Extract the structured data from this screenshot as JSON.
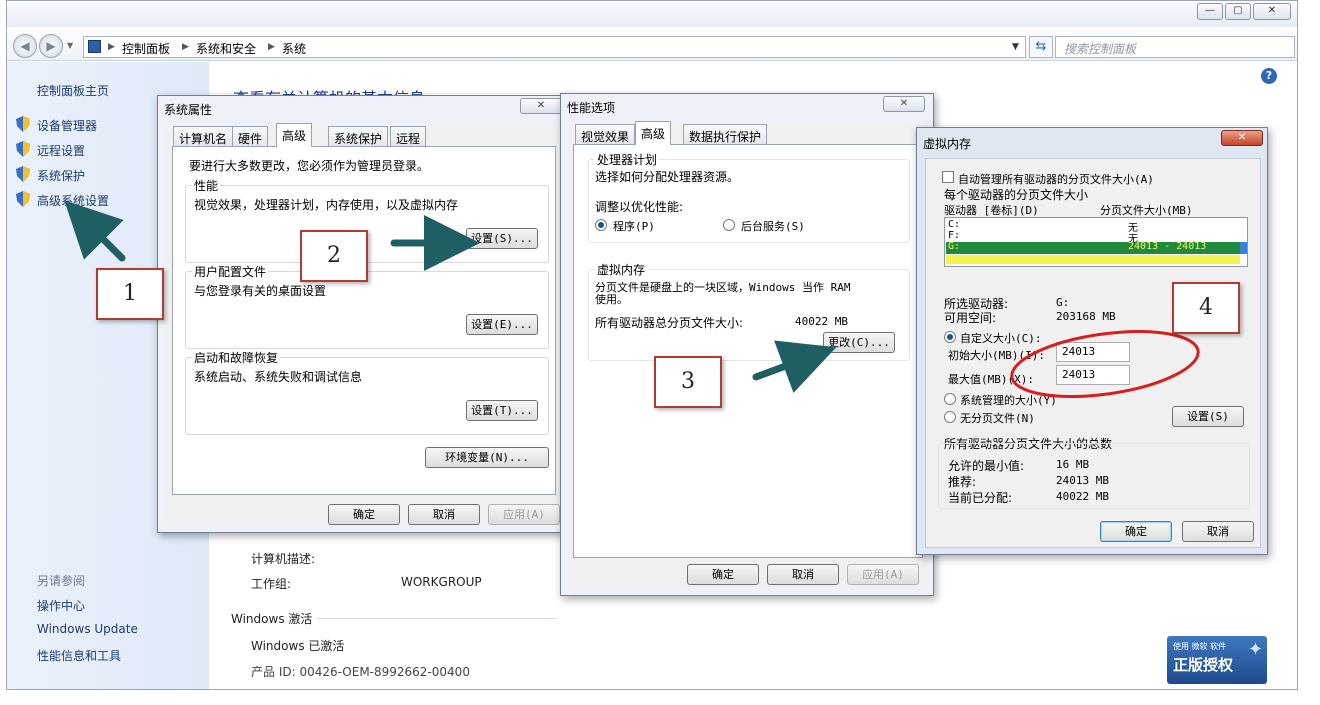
{
  "main_window": {
    "breadcrumb": [
      "控制面板",
      "系统和安全",
      "系统"
    ],
    "search_placeholder": "搜索控制面板",
    "heading": "查看有关计算机的基本信息",
    "left_pane": {
      "home": "控制面板主页",
      "items": [
        "设备管理器",
        "远程设置",
        "系统保护",
        "高级系统设置"
      ],
      "see_also_title": "另请参阅",
      "see_also": [
        "操作中心",
        "Windows Update",
        "性能信息和工具"
      ]
    },
    "computer_desc_label": "计算机描述:",
    "workgroup_label": "工作组:",
    "workgroup_value": "WORKGROUP",
    "activation_title": "Windows 激活",
    "activation_status": "Windows 已激活",
    "product_id_partial": "产品 ID: 00426-OEM-8992662-00400",
    "genuine_badge_top": "使用 微软 软件",
    "genuine_badge_main": "正版授权"
  },
  "system_properties": {
    "title": "系统属性",
    "tabs": [
      "计算机名",
      "硬件",
      "高级",
      "系统保护",
      "远程"
    ],
    "active_tab": "高级",
    "admin_note": "要进行大多数更改，您必须作为管理员登录。",
    "performance": {
      "label": "性能",
      "desc": "视觉效果，处理器计划，内存使用，以及虚拟内存",
      "button": "设置(S)..."
    },
    "user_profiles": {
      "label": "用户配置文件",
      "desc": "与您登录有关的桌面设置",
      "button": "设置(E)..."
    },
    "startup_recovery": {
      "label": "启动和故障恢复",
      "desc": "系统启动、系统失败和调试信息",
      "button": "设置(T)..."
    },
    "env_button": "环境变量(N)...",
    "ok": "确定",
    "cancel": "取消",
    "apply": "应用(A)"
  },
  "performance_options": {
    "title": "性能选项",
    "tabs": [
      "视觉效果",
      "高级",
      "数据执行保护"
    ],
    "active_tab": "高级",
    "processor": {
      "label": "处理器计划",
      "desc": "选择如何分配处理器资源。",
      "adjust": "调整以优化性能:",
      "programs": "程序(P)",
      "background": "后台服务(S)"
    },
    "virtual_memory": {
      "label": "虚拟内存",
      "desc": "分页文件是硬盘上的一块区域，Windows 当作 RAM 使用。",
      "total_label": "所有驱动器总分页文件大小:",
      "total_value": "40022 MB",
      "change_button": "更改(C)..."
    },
    "ok": "确定",
    "cancel": "取消",
    "apply": "应用(A)"
  },
  "virtual_memory": {
    "title": "虚拟内存",
    "auto_manage": "自动管理所有驱动器的分页文件大小(A)",
    "per_drive_label": "每个驱动器的分页文件大小",
    "col_drive": "驱动器 [卷标](D)",
    "col_size": "分页文件大小(MB)",
    "drives": [
      {
        "drive": "C:",
        "size": "无"
      },
      {
        "drive": "F:",
        "size": "无"
      },
      {
        "drive": "G:",
        "size": "24013 - 24013"
      }
    ],
    "selected_drive_label": "所选驱动器:",
    "selected_drive_value": "G:",
    "free_space_label": "可用空间:",
    "free_space_value": "203168 MB",
    "custom_size": "自定义大小(C):",
    "initial_label": "初始大小(MB)(I):",
    "initial_value": "24013",
    "max_label": "最大值(MB)(X):",
    "max_value": "24013",
    "system_managed": "系统管理的大小(Y)",
    "no_paging": "无分页文件(N)",
    "set_button": "设置(S)",
    "totals_label": "所有驱动器分页文件大小的总数",
    "min_label": "允许的最小值:",
    "min_value": "16 MB",
    "recommended_label": "推荐:",
    "recommended_value": "24013 MB",
    "allocated_label": "当前已分配:",
    "allocated_value": "40022 MB",
    "ok": "确定",
    "cancel": "取消"
  },
  "callouts": [
    "1",
    "2",
    "3",
    "4"
  ],
  "colors": {
    "callout_border": "#b33a2e",
    "arrow": "#1f5f63",
    "selected_row": "#1e8a3c",
    "highlight": "#f3f34a",
    "ellipse": "#d81e1e"
  }
}
